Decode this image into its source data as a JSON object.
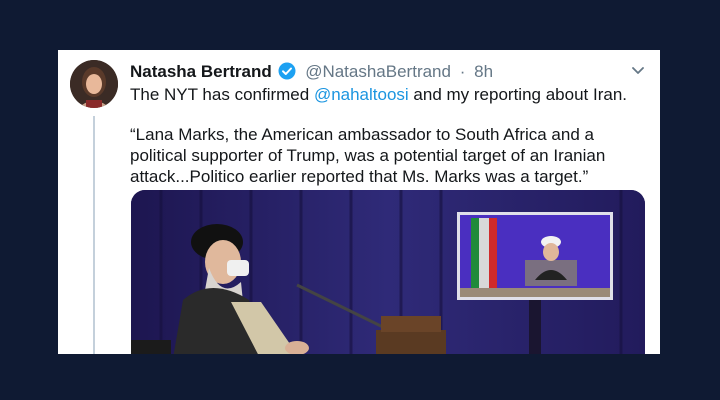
{
  "tweet": {
    "author_name": "Natasha Bertrand",
    "handle": "@NatashaBertrand",
    "separator": "·",
    "time": "8h",
    "lead_before": "The NYT has confirmed ",
    "mention": "@nahaltoosi",
    "lead_after": " and my reporting about Iran.",
    "quote": "“Lana Marks, the American ambassador to South Africa and a political supporter of Trump, was a potential target of an Iranian attack...Politico earlier reported that Ms. Marks was a target.”"
  },
  "colors": {
    "background": "#0f1a33",
    "card": "#ffffff",
    "text": "#14171a",
    "muted": "#657786",
    "link": "#1b95e0",
    "verified": "#1da1f2"
  },
  "icons": {
    "verified": "verified-badge-icon",
    "menu": "chevron-down-icon"
  }
}
